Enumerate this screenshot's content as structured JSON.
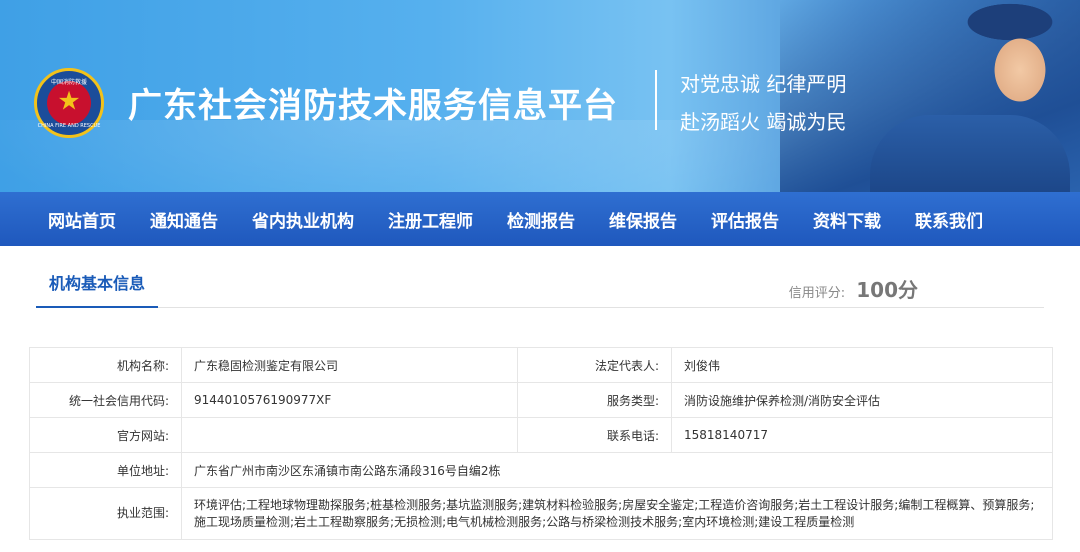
{
  "header": {
    "logo": {
      "top_text": "中国消防救援",
      "bottom_text": "CHINA FIRE AND RESCUE",
      "icon": "fire-rescue-emblem-icon"
    },
    "site_title": "广东社会消防技术服务信息平台",
    "slogan_line1": "对党忠诚 纪律严明",
    "slogan_line2": "赴汤蹈火 竭诚为民"
  },
  "nav": {
    "items": [
      "网站首页",
      "通知通告",
      "省内执业机构",
      "注册工程师",
      "检测报告",
      "维保报告",
      "评估报告",
      "资料下载",
      "联系我们"
    ]
  },
  "tab": {
    "label": "机构基本信息",
    "score_label": "信用评分:",
    "score_value": "100分"
  },
  "info": {
    "name_label": "机构名称:",
    "name_value": "广东稳固检测鉴定有限公司",
    "legal_rep_label": "法定代表人:",
    "legal_rep_value": "刘俊伟",
    "credit_code_label": "统一社会信用代码:",
    "credit_code_value": "9144010576190977XF",
    "service_type_label": "服务类型:",
    "service_type_value": "消防设施维护保养检测/消防安全评估",
    "website_label": "官方网站:",
    "website_value": "",
    "phone_label": "联系电话:",
    "phone_value": "15818140717",
    "address_label": "单位地址:",
    "address_value": "广东省广州市南沙区东涌镇市南公路东涌段316号自编2栋",
    "scope_label": "执业范围:",
    "scope_value": "环境评估;工程地球物理勘探服务;桩基检测服务;基坑监测服务;建筑材料检验服务;房屋安全鉴定;工程造价咨询服务;岩土工程设计服务;编制工程概算、预算服务;施工现场质量检测;岩土工程勘察服务;无损检测;电气机械检测服务;公路与桥梁检测技术服务;室内环境检测;建设工程质量检测"
  },
  "colors": {
    "nav_bg": "#2563c4",
    "accent": "#1a5bb8",
    "banner": "#4aa6ea"
  }
}
